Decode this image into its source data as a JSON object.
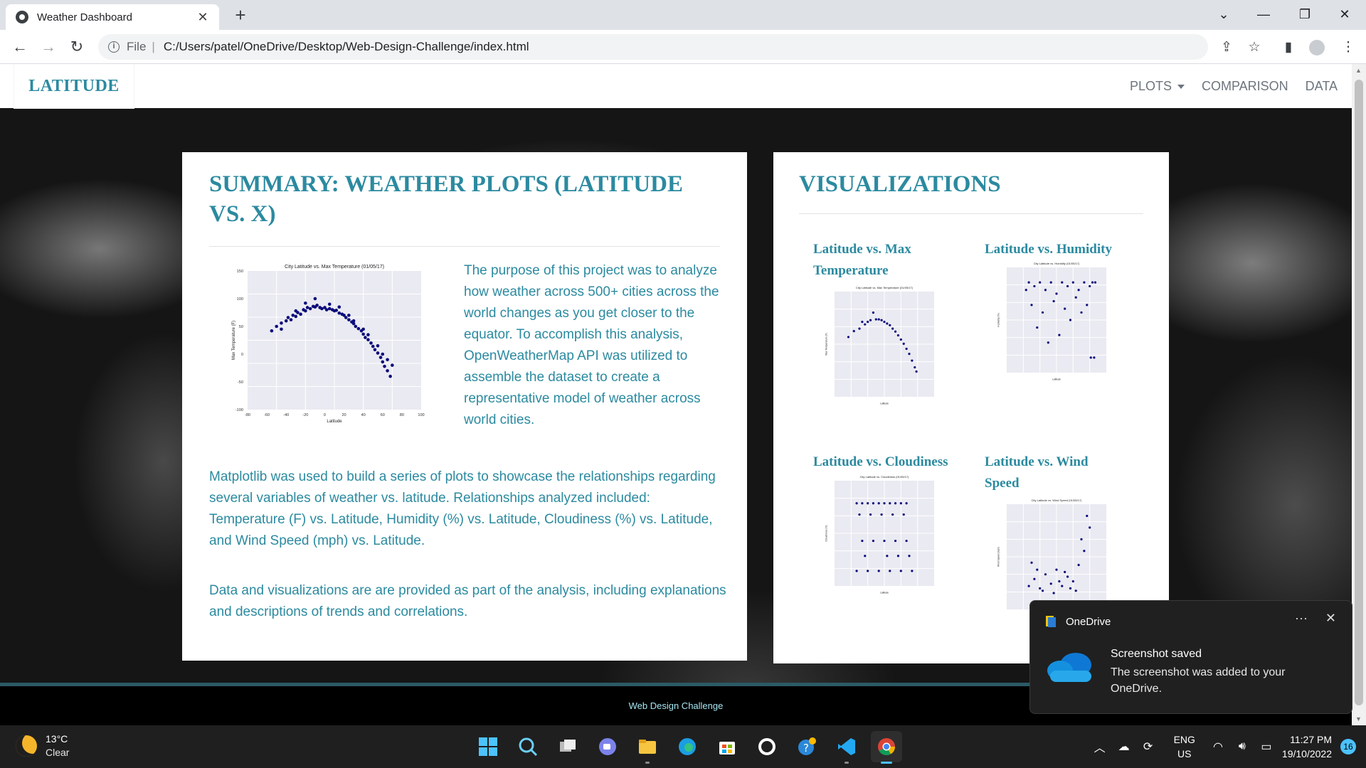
{
  "browser": {
    "tab_title": "Weather Dashboard",
    "tab_close": "✕",
    "new_tab": "+",
    "address_prefix": "File",
    "url": "C:/Users/patel/OneDrive/Desktop/Web-Design-Challenge/index.html"
  },
  "site": {
    "brand": "LATITUDE",
    "nav": {
      "plots": "PLOTS",
      "comparison": "COMPARISON",
      "data": "DATA"
    }
  },
  "summary": {
    "heading": "SUMMARY: WEATHER PLOTS (LATITUDE VS. X)",
    "intro": "The purpose of this project was to analyze how weather across 500+ cities across the world changes as you get closer to the equator. To accomplish this analysis, OpenWeatherMap API was utilized to assemble the dataset to create a representative model of weather across world cities.",
    "paragraph2": "Matplotlib was used to build a series of plots to showcase the relationships regarding several variables of weather vs. latitude. Relationships analyzed included: Temperature (F) vs. Latitude, Humidity (%) vs. Latitude, Cloudiness (%) vs. Latitude, and Wind Speed (mph) vs. Latitude.",
    "paragraph3": "Data and visualizations are are provided as part of the analysis, including explanations and descriptions of trends and correlations."
  },
  "visualizations": {
    "heading": "VISUALIZATIONS",
    "items": [
      {
        "title": "Latitude vs. Max Temperature"
      },
      {
        "title": "Latitude vs. Humidity"
      },
      {
        "title": "Latitude vs. Cloudiness"
      },
      {
        "title": "Latitude vs. Wind Speed"
      }
    ]
  },
  "footer": {
    "text": "Web Design Challenge"
  },
  "toast": {
    "app": "OneDrive",
    "more": "···",
    "close": "✕",
    "title": "Screenshot saved",
    "body": "The screenshot was added to your OneDrive."
  },
  "taskbar": {
    "temp": "13°C",
    "condition": "Clear",
    "lang_top": "ENG",
    "lang_bottom": "US",
    "time": "11:27 PM",
    "date": "19/10/2022",
    "notifications": "16"
  },
  "chart_data": [
    {
      "type": "scatter",
      "title": "City Latitude vs. Max Temperature (01/05/17)",
      "xlabel": "Latitude",
      "ylabel": "Max Temperature (F)",
      "xlim": [
        -80,
        100
      ],
      "ylim": [
        -100,
        150
      ],
      "xticks": [
        -80,
        -60,
        -40,
        -20,
        0,
        20,
        40,
        60,
        80,
        100
      ],
      "yticks": [
        150,
        100,
        50,
        0,
        -50,
        -100
      ],
      "shape": "inverted-parabola",
      "points": [
        [
          -55,
          42
        ],
        [
          -50,
          50
        ],
        [
          -45,
          56
        ],
        [
          -40,
          60
        ],
        [
          -38,
          66
        ],
        [
          -35,
          62
        ],
        [
          -33,
          70
        ],
        [
          -30,
          68
        ],
        [
          -28,
          75
        ],
        [
          -25,
          72
        ],
        [
          -22,
          80
        ],
        [
          -20,
          78
        ],
        [
          -18,
          84
        ],
        [
          -15,
          82
        ],
        [
          -12,
          86
        ],
        [
          -10,
          85
        ],
        [
          -8,
          88
        ],
        [
          -5,
          84
        ],
        [
          -3,
          82
        ],
        [
          0,
          84
        ],
        [
          2,
          80
        ],
        [
          5,
          82
        ],
        [
          8,
          80
        ],
        [
          10,
          78
        ],
        [
          12,
          79
        ],
        [
          15,
          74
        ],
        [
          18,
          72
        ],
        [
          20,
          70
        ],
        [
          22,
          66
        ],
        [
          25,
          62
        ],
        [
          28,
          58
        ],
        [
          30,
          55
        ],
        [
          32,
          50
        ],
        [
          35,
          46
        ],
        [
          38,
          42
        ],
        [
          40,
          36
        ],
        [
          42,
          30
        ],
        [
          45,
          26
        ],
        [
          48,
          20
        ],
        [
          50,
          14
        ],
        [
          52,
          8
        ],
        [
          55,
          2
        ],
        [
          58,
          -6
        ],
        [
          60,
          -14
        ],
        [
          62,
          -22
        ],
        [
          65,
          -30
        ],
        [
          68,
          -40
        ],
        [
          -45,
          45
        ],
        [
          -30,
          78
        ],
        [
          -20,
          92
        ],
        [
          -10,
          100
        ],
        [
          5,
          90
        ],
        [
          15,
          85
        ],
        [
          25,
          70
        ],
        [
          40,
          45
        ],
        [
          55,
          15
        ],
        [
          60,
          0
        ],
        [
          65,
          -10
        ],
        [
          70,
          -20
        ],
        [
          45,
          35
        ],
        [
          30,
          60
        ]
      ]
    },
    {
      "type": "scatter",
      "title": "City Latitude vs. Max Temperature (01/05/17)",
      "xlabel": "Latitude",
      "ylabel": "Max Temperature (F)",
      "xlim": [
        -80,
        100
      ],
      "ylim": [
        -100,
        150
      ],
      "points": [
        [
          -55,
          42
        ],
        [
          -45,
          56
        ],
        [
          -35,
          62
        ],
        [
          -25,
          72
        ],
        [
          -15,
          82
        ],
        [
          -5,
          84
        ],
        [
          5,
          82
        ],
        [
          15,
          74
        ],
        [
          25,
          62
        ],
        [
          35,
          46
        ],
        [
          45,
          26
        ],
        [
          55,
          2
        ],
        [
          65,
          -30
        ],
        [
          -30,
          78
        ],
        [
          -10,
          100
        ],
        [
          30,
          55
        ],
        [
          50,
          14
        ],
        [
          60,
          -14
        ],
        [
          68,
          -40
        ],
        [
          20,
          70
        ],
        [
          40,
          36
        ],
        [
          10,
          78
        ],
        [
          0,
          84
        ],
        [
          -20,
          78
        ]
      ]
    },
    {
      "type": "scatter",
      "title": "City Latitude vs. Humidity (01/05/17)",
      "xlabel": "Latitude",
      "ylabel": "Humidity (%)",
      "xlim": [
        -80,
        100
      ],
      "ylim": [
        -20,
        120
      ],
      "points": [
        [
          -40,
          100
        ],
        [
          -30,
          95
        ],
        [
          -20,
          100
        ],
        [
          -10,
          90
        ],
        [
          0,
          100
        ],
        [
          10,
          85
        ],
        [
          20,
          100
        ],
        [
          30,
          95
        ],
        [
          40,
          100
        ],
        [
          50,
          90
        ],
        [
          60,
          100
        ],
        [
          70,
          95
        ],
        [
          -35,
          70
        ],
        [
          -15,
          60
        ],
        [
          5,
          75
        ],
        [
          25,
          65
        ],
        [
          45,
          80
        ],
        [
          65,
          70
        ],
        [
          -25,
          40
        ],
        [
          15,
          30
        ],
        [
          35,
          50
        ],
        [
          55,
          60
        ],
        [
          -5,
          20
        ],
        [
          75,
          100
        ],
        [
          72,
          0
        ],
        [
          78,
          0
        ],
        [
          -45,
          90
        ],
        [
          80,
          100
        ]
      ]
    },
    {
      "type": "scatter",
      "title": "City Latitude vs. Cloudiness (01/05/17)",
      "xlabel": "Latitude",
      "ylabel": "Cloudiness (%)",
      "xlim": [
        -80,
        100
      ],
      "ylim": [
        -20,
        120
      ],
      "points": [
        [
          -40,
          90
        ],
        [
          -30,
          90
        ],
        [
          -20,
          90
        ],
        [
          -10,
          90
        ],
        [
          0,
          90
        ],
        [
          10,
          90
        ],
        [
          20,
          90
        ],
        [
          30,
          90
        ],
        [
          40,
          90
        ],
        [
          50,
          90
        ],
        [
          -35,
          75
        ],
        [
          -15,
          75
        ],
        [
          5,
          75
        ],
        [
          25,
          75
        ],
        [
          45,
          75
        ],
        [
          -40,
          0
        ],
        [
          -20,
          0
        ],
        [
          0,
          0
        ],
        [
          20,
          0
        ],
        [
          40,
          0
        ],
        [
          60,
          0
        ],
        [
          -30,
          40
        ],
        [
          -10,
          40
        ],
        [
          10,
          40
        ],
        [
          30,
          40
        ],
        [
          50,
          40
        ],
        [
          -25,
          20
        ],
        [
          15,
          20
        ],
        [
          35,
          20
        ],
        [
          55,
          20
        ]
      ]
    },
    {
      "type": "scatter",
      "title": "City Latitude vs. Wind Speed (01/05/17)",
      "xlabel": "Latitude",
      "ylabel": "Wind Speed (mph)",
      "xlim": [
        -80,
        100
      ],
      "ylim": [
        -5,
        40
      ],
      "points": [
        [
          -40,
          5
        ],
        [
          -30,
          8
        ],
        [
          -20,
          4
        ],
        [
          -10,
          10
        ],
        [
          0,
          6
        ],
        [
          10,
          12
        ],
        [
          20,
          5
        ],
        [
          30,
          9
        ],
        [
          40,
          7
        ],
        [
          50,
          14
        ],
        [
          60,
          20
        ],
        [
          70,
          30
        ],
        [
          -35,
          15
        ],
        [
          -15,
          3
        ],
        [
          5,
          2
        ],
        [
          25,
          11
        ],
        [
          45,
          3
        ],
        [
          55,
          25
        ],
        [
          65,
          35
        ],
        [
          -25,
          12
        ],
        [
          15,
          7
        ],
        [
          35,
          4
        ]
      ]
    }
  ]
}
